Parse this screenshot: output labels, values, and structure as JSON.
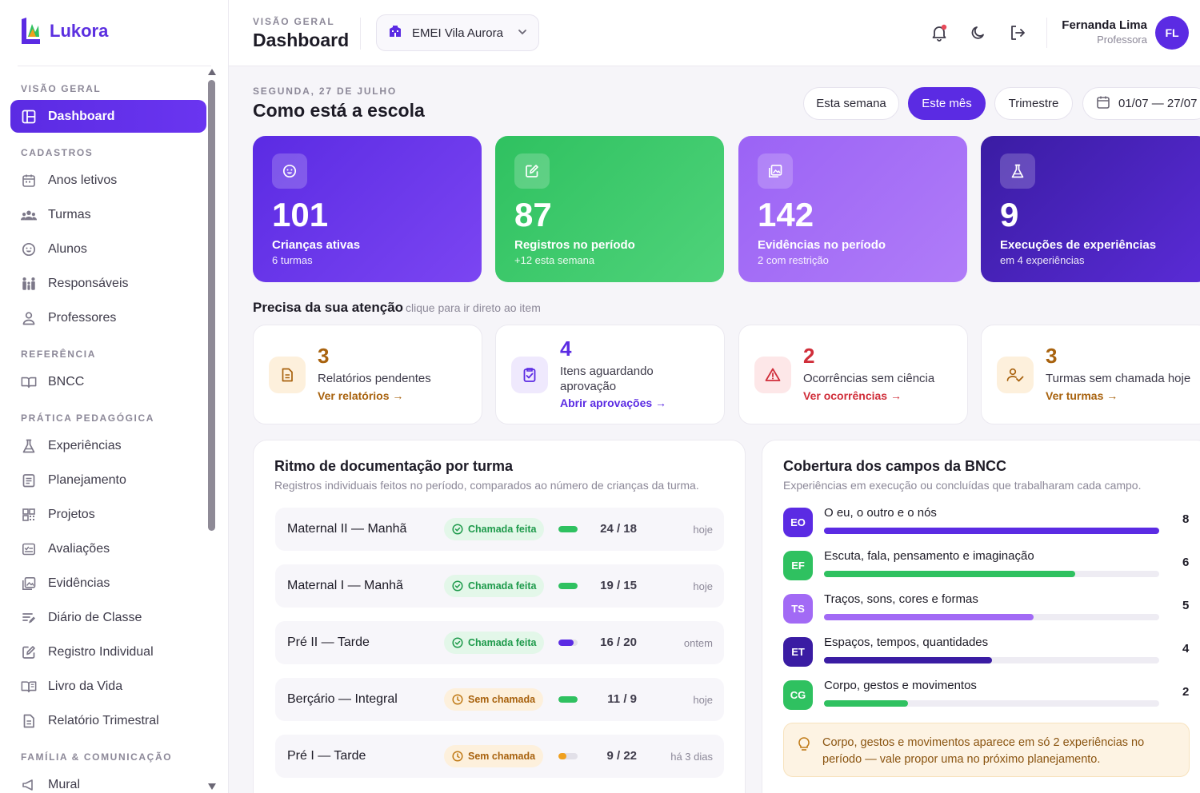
{
  "app": {
    "name": "Lukora"
  },
  "sidebar": {
    "sections": [
      {
        "title": "VISÃO GERAL",
        "items": [
          {
            "label": "Dashboard",
            "icon": "dashboard-icon",
            "active": true
          }
        ]
      },
      {
        "title": "CADASTROS",
        "items": [
          {
            "label": "Anos letivos",
            "icon": "calendar-icon"
          },
          {
            "label": "Turmas",
            "icon": "group-icon"
          },
          {
            "label": "Alunos",
            "icon": "smile-icon"
          },
          {
            "label": "Responsáveis",
            "icon": "family-icon"
          },
          {
            "label": "Professores",
            "icon": "user-icon"
          }
        ]
      },
      {
        "title": "REFERÊNCIA",
        "items": [
          {
            "label": "BNCC",
            "icon": "book-open-icon"
          }
        ]
      },
      {
        "title": "PRÁTICA PEDAGÓGICA",
        "items": [
          {
            "label": "Experiências",
            "icon": "flask-icon"
          },
          {
            "label": "Planejamento",
            "icon": "planner-icon"
          },
          {
            "label": "Projetos",
            "icon": "grid-icon"
          },
          {
            "label": "Avaliações",
            "icon": "checklist-icon"
          },
          {
            "label": "Evidências",
            "icon": "gallery-icon"
          },
          {
            "label": "Diário de Classe",
            "icon": "notes-icon"
          },
          {
            "label": "Registro Individual",
            "icon": "edit-icon"
          },
          {
            "label": "Livro da Vida",
            "icon": "book-icon"
          },
          {
            "label": "Relatório Trimestral",
            "icon": "document-icon"
          }
        ]
      },
      {
        "title": "FAMÍLIA & COMUNICAÇÃO",
        "items": [
          {
            "label": "Mural",
            "icon": "megaphone-icon"
          }
        ]
      }
    ]
  },
  "topbar": {
    "eyebrow": "VISÃO GERAL",
    "title": "Dashboard",
    "school": "EMEI Vila Aurora",
    "user": {
      "name": "Fernanda Lima",
      "role": "Professora",
      "initials": "FL"
    }
  },
  "main": {
    "date": "SEGUNDA, 27 DE JULHO",
    "heading": "Como está a escola",
    "periods": [
      "Esta semana",
      "Este mês",
      "Trimestre"
    ],
    "active_period": "Este mês",
    "range": "01/07 — 27/07",
    "kpis": [
      {
        "value": "101",
        "label": "Crianças ativas",
        "sub": "6 turmas",
        "icon": "smile-icon",
        "gradient": [
          "#5b2be3",
          "#7b45f2"
        ]
      },
      {
        "value": "87",
        "label": "Registros no período",
        "sub": "+12 esta semana",
        "icon": "edit-icon",
        "gradient": [
          "#2fc160",
          "#4fd37a"
        ]
      },
      {
        "value": "142",
        "label": "Evidências no período",
        "sub": "2 com restrição",
        "icon": "gallery-icon",
        "gradient": [
          "#9b63f5",
          "#b07cf8"
        ]
      },
      {
        "value": "9",
        "label": "Execuções de experiências",
        "sub": "em 4 experiências",
        "icon": "flask-icon",
        "gradient": [
          "#3a1ca3",
          "#5a2bd6"
        ]
      }
    ],
    "attention": {
      "title": "Precisa da sua atenção",
      "hint": "clique para ir direto ao item",
      "cards": [
        {
          "value": "3",
          "label": "Relatórios pendentes",
          "link": "Ver relatórios →",
          "icon": "document-icon",
          "color": "#a8620e",
          "bg": "#fdf0dc"
        },
        {
          "value": "4",
          "label": "Itens aguardando aprovação",
          "link": "Abrir aprovações →",
          "icon": "clipboard-check-icon",
          "color": "#5b2be3",
          "bg": "#efe9fd"
        },
        {
          "value": "2",
          "label": "Ocorrências sem ciência",
          "link": "Ver ocorrências →",
          "icon": "warning-icon",
          "color": "#d02e3a",
          "bg": "#fde7e8"
        },
        {
          "value": "3",
          "label": "Turmas sem chamada hoje",
          "link": "Ver turmas →",
          "icon": "user-check-icon",
          "color": "#a8620e",
          "bg": "#fdf0dc"
        }
      ]
    },
    "rhythm": {
      "title": "Ritmo de documentação por turma",
      "subtitle": "Registros individuais feitos no período, comparados ao número de crianças da turma.",
      "rows": [
        {
          "name": "Maternal II — Manhã",
          "status": "Chamada feita",
          "ok": true,
          "ratio": "24 / 18",
          "when": "hoje",
          "fill": 1.0,
          "color": "#2fc160"
        },
        {
          "name": "Maternal I — Manhã",
          "status": "Chamada feita",
          "ok": true,
          "ratio": "19 / 15",
          "when": "hoje",
          "fill": 1.0,
          "color": "#2fc160"
        },
        {
          "name": "Pré II — Tarde",
          "status": "Chamada feita",
          "ok": true,
          "ratio": "16 / 20",
          "when": "ontem",
          "fill": 0.8,
          "color": "#5b2be3"
        },
        {
          "name": "Berçário — Integral",
          "status": "Sem chamada",
          "ok": false,
          "ratio": "11 / 9",
          "when": "hoje",
          "fill": 1.0,
          "color": "#2fc160"
        },
        {
          "name": "Pré I — Tarde",
          "status": "Sem chamada",
          "ok": false,
          "ratio": "9 / 22",
          "when": "há 3 dias",
          "fill": 0.41,
          "color": "#f0a01e"
        }
      ]
    },
    "bncc": {
      "title": "Cobertura dos campos da BNCC",
      "subtitle": "Experiências em execução ou concluídas que trabalharam cada campo.",
      "max": 8,
      "fields": [
        {
          "code": "EO",
          "name": "O eu, o outro e o nós",
          "count": 8,
          "color": "#5b2be3"
        },
        {
          "code": "EF",
          "name": "Escuta, fala, pensamento e imaginação",
          "count": 6,
          "color": "#2fc160"
        },
        {
          "code": "TS",
          "name": "Traços, sons, cores e formas",
          "count": 5,
          "color": "#a26af5"
        },
        {
          "code": "ET",
          "name": "Espaços, tempos, quantidades",
          "count": 4,
          "color": "#3a1ca3"
        },
        {
          "code": "CG",
          "name": "Corpo, gestos e movimentos",
          "count": 2,
          "color": "#2fc160"
        }
      ],
      "tip": "Corpo, gestos e movimentos aparece em só 2 experiências no período — vale propor uma no próximo planejamento."
    }
  }
}
